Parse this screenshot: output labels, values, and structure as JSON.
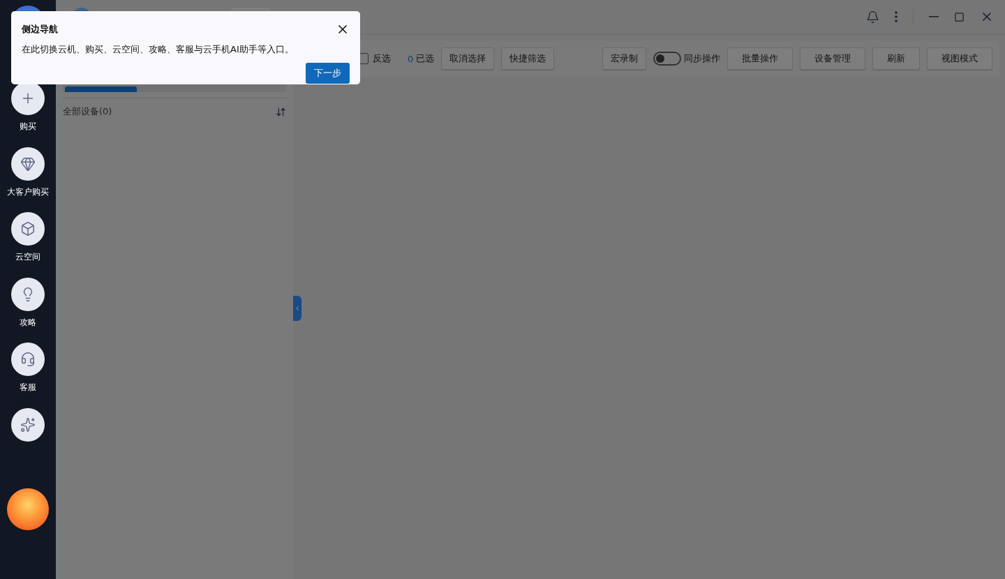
{
  "sidebar": {
    "items": [
      {
        "label": "购买"
      },
      {
        "label": "大客户购买"
      },
      {
        "label": "云空间"
      },
      {
        "label": "攻略"
      },
      {
        "label": "客服"
      }
    ]
  },
  "toolbar": {
    "invert": {
      "label": "反选",
      "checked": false
    },
    "selected_count": "0",
    "selected_label": "已选",
    "left_buttons": [
      "取消选择",
      "快捷筛选"
    ],
    "macro_button": "宏录制",
    "sync": {
      "label": "同步操作",
      "on": false
    },
    "right_buttons": [
      "批量操作",
      "设备管理",
      "刷新",
      "视图模式"
    ]
  },
  "device_panel": {
    "group_label": "全部设备(0)"
  },
  "tour": {
    "title": "侧边导航",
    "body": "在此切换云机、购买、云空间、攻略、客服与云手机AI助手等入口。",
    "next_button": "下一步"
  }
}
